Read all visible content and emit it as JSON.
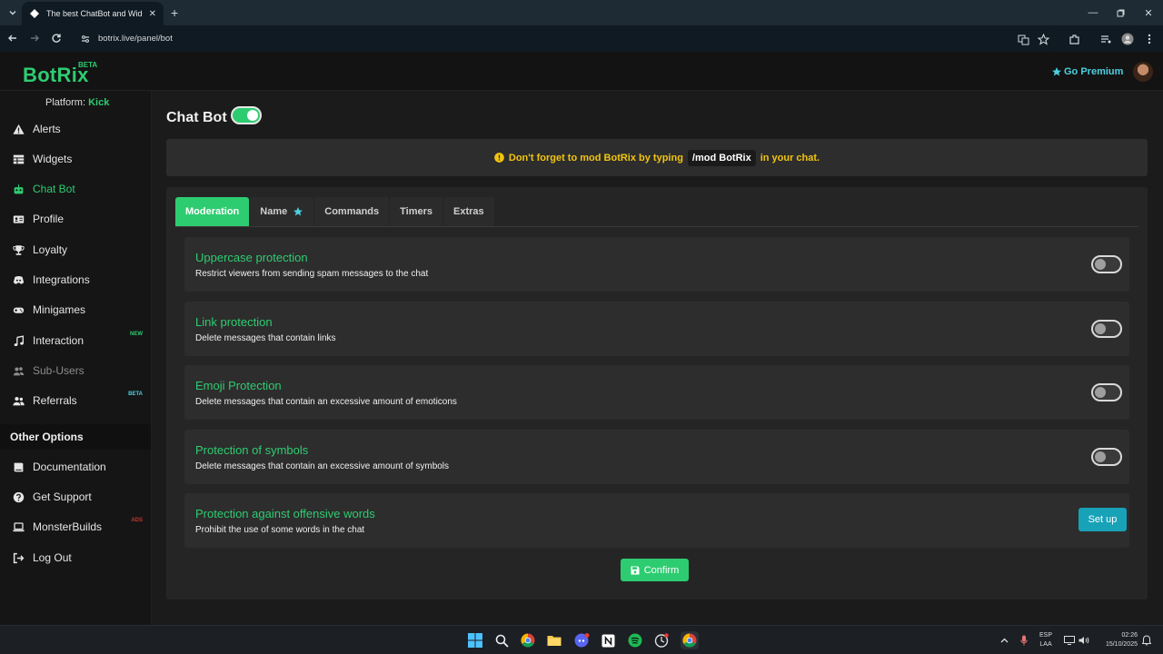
{
  "browser": {
    "tab_title": "The best ChatBot and Widgets",
    "url": "botrix.live/panel/bot"
  },
  "header": {
    "logo": "BotRix",
    "logo_badge": "BETA",
    "premium_label": "Go Premium"
  },
  "sidebar": {
    "platform_label": "Platform:",
    "platform_value": "Kick",
    "items": [
      {
        "label": "Alerts",
        "icon": "warning-icon"
      },
      {
        "label": "Widgets",
        "icon": "table-icon"
      },
      {
        "label": "Chat Bot",
        "icon": "robot-icon",
        "active": true
      },
      {
        "label": "Profile",
        "icon": "id-card-icon"
      },
      {
        "label": "Loyalty",
        "icon": "trophy-icon"
      },
      {
        "label": "Integrations",
        "icon": "discord-icon"
      },
      {
        "label": "Minigames",
        "icon": "gamepad-icon"
      },
      {
        "label": "Interaction",
        "icon": "music-icon",
        "badge": "NEW"
      },
      {
        "label": "Sub-Users",
        "icon": "users-icon",
        "disabled": true
      },
      {
        "label": "Referrals",
        "icon": "user-friends-icon",
        "badge": "BETA"
      }
    ],
    "other_options_title": "Other Options",
    "other_items": [
      {
        "label": "Documentation",
        "icon": "book-icon"
      },
      {
        "label": "Get Support",
        "icon": "question-icon"
      },
      {
        "label": "MonsterBuilds",
        "icon": "laptop-icon",
        "badge": "ADS"
      },
      {
        "label": "Log Out",
        "icon": "sign-out-icon"
      }
    ]
  },
  "main": {
    "title": "Chat Bot",
    "bot_enabled": true,
    "notice_prefix": "Don't forget to mod BotRix by typing",
    "notice_code": "/mod BotRix",
    "notice_suffix": "in your chat.",
    "tabs": [
      {
        "label": "Moderation",
        "active": true
      },
      {
        "label": "Name",
        "star": true
      },
      {
        "label": "Commands"
      },
      {
        "label": "Timers"
      },
      {
        "label": "Extras"
      }
    ],
    "settings": [
      {
        "title": "Uppercase protection",
        "description": "Restrict viewers from sending spam messages to the chat",
        "control": "toggle",
        "enabled": false
      },
      {
        "title": "Link protection",
        "description": "Delete messages that contain links",
        "control": "toggle",
        "enabled": false
      },
      {
        "title": "Emoji Protection",
        "description": "Delete messages that contain an excessive amount of emoticons",
        "control": "toggle",
        "enabled": false
      },
      {
        "title": "Protection of symbols",
        "description": "Delete messages that contain an excessive amount of symbols",
        "control": "toggle",
        "enabled": false
      },
      {
        "title": "Protection against offensive words",
        "description": "Prohibit the use of some words in the chat",
        "control": "button",
        "button_label": "Set up"
      }
    ],
    "confirm_label": "Confirm"
  },
  "taskbar": {
    "lang_line1": "ESP",
    "lang_line2": "LAA",
    "time": "02:26",
    "date": "15/10/2025"
  },
  "colors": {
    "accent": "#2ecc71",
    "premium": "#4dd0e1",
    "notice": "#f1c40f",
    "setup_button": "#17a2b8"
  }
}
